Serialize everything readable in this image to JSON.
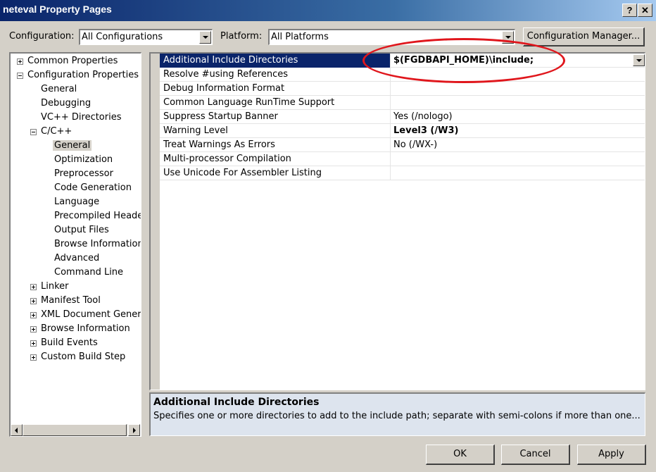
{
  "window": {
    "title": "neteval Property Pages",
    "help_btn": "?",
    "close_btn": "✕"
  },
  "toolbar": {
    "configuration_label": "Configuration:",
    "configuration_value": "All Configurations",
    "platform_label": "Platform:",
    "platform_value": "All Platforms",
    "config_manager_label": "Configuration Manager..."
  },
  "tree": {
    "items": [
      {
        "label": "Common Properties",
        "expander": "plus"
      },
      {
        "label": "Configuration Properties",
        "expander": "minus"
      },
      {
        "label": "General"
      },
      {
        "label": "Debugging"
      },
      {
        "label": "VC++ Directories"
      },
      {
        "label": "C/C++",
        "expander": "minus"
      },
      {
        "label": "General",
        "selected": true
      },
      {
        "label": "Optimization"
      },
      {
        "label": "Preprocessor"
      },
      {
        "label": "Code Generation"
      },
      {
        "label": "Language"
      },
      {
        "label": "Precompiled Headers"
      },
      {
        "label": "Output Files"
      },
      {
        "label": "Browse Information"
      },
      {
        "label": "Advanced"
      },
      {
        "label": "Command Line"
      },
      {
        "label": "Linker",
        "expander": "plus"
      },
      {
        "label": "Manifest Tool",
        "expander": "plus"
      },
      {
        "label": "XML Document Generator",
        "expander": "plus"
      },
      {
        "label": "Browse Information",
        "expander": "plus"
      },
      {
        "label": "Build Events",
        "expander": "plus"
      },
      {
        "label": "Custom Build Step",
        "expander": "plus"
      }
    ]
  },
  "properties": {
    "rows": [
      {
        "name": "Additional Include Directories",
        "value": "$(FGDBAPI_HOME)\\include;",
        "selected": true,
        "bold": true
      },
      {
        "name": "Resolve #using References",
        "value": ""
      },
      {
        "name": "Debug Information Format",
        "value": ""
      },
      {
        "name": "Common Language RunTime Support",
        "value": ""
      },
      {
        "name": "Suppress Startup Banner",
        "value": "Yes (/nologo)"
      },
      {
        "name": "Warning Level",
        "value": "Level3 (/W3)",
        "bold": true
      },
      {
        "name": "Treat Warnings As Errors",
        "value": "No (/WX-)"
      },
      {
        "name": "Multi-processor Compilation",
        "value": ""
      },
      {
        "name": "Use Unicode For Assembler Listing",
        "value": ""
      }
    ]
  },
  "description": {
    "title": "Additional Include Directories",
    "text": "Specifies one or more directories to add to the include path; separate with semi-colons if more than one..."
  },
  "buttons": {
    "ok": "OK",
    "cancel": "Cancel",
    "apply": "Apply"
  },
  "colors": {
    "selection": "#0a246a",
    "highlight_circle": "#e0161c",
    "face": "#d4d0c8"
  }
}
